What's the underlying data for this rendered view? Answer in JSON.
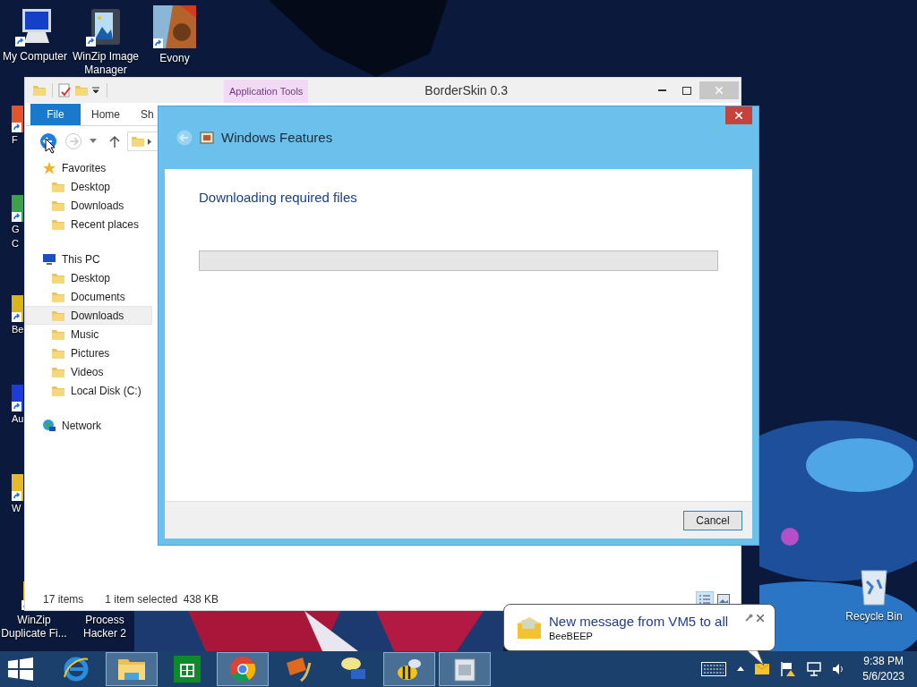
{
  "desktop": {
    "top_icons": [
      {
        "lines": [
          "My Computer"
        ]
      },
      {
        "lines": [
          "WinZip Image",
          "Manager"
        ]
      },
      {
        "lines": [
          "Evony"
        ]
      }
    ],
    "left_icons": [
      {
        "lines": [
          "F"
        ]
      },
      {
        "lines": [
          "G",
          "C"
        ]
      },
      {
        "lines": [
          "Be"
        ]
      },
      {
        "lines": [
          "Au"
        ]
      },
      {
        "lines": [
          "W"
        ]
      }
    ],
    "bottom_icons": [
      {
        "lines": [
          "WinZip",
          "Duplicate Fi..."
        ]
      },
      {
        "lines": [
          "Process",
          "Hacker 2"
        ]
      }
    ],
    "recycle_bin": {
      "lines": [
        "Recycle Bin"
      ]
    }
  },
  "explorer": {
    "title": "BorderSkin 0.3",
    "contextual_tab": "Application Tools",
    "ribbon_tabs": [
      {
        "label": "File",
        "selected": true
      },
      {
        "label": "Home",
        "selected": false
      },
      {
        "label": "Sh",
        "selected": false
      }
    ],
    "nav_pane": [
      {
        "label": "Favorites",
        "selected": false,
        "children": [
          {
            "label": "Desktop",
            "selected": false
          },
          {
            "label": "Downloads",
            "selected": false
          },
          {
            "label": "Recent places",
            "selected": false
          }
        ]
      },
      {
        "label": "This PC",
        "selected": false,
        "children": [
          {
            "label": "Desktop",
            "selected": false
          },
          {
            "label": "Documents",
            "selected": false
          },
          {
            "label": "Downloads",
            "selected": true
          },
          {
            "label": "Music",
            "selected": false
          },
          {
            "label": "Pictures",
            "selected": false
          },
          {
            "label": "Videos",
            "selected": false
          },
          {
            "label": "Local Disk (C:)",
            "selected": false
          }
        ]
      },
      {
        "label": "Network",
        "selected": false
      }
    ],
    "status_bar": {
      "items": "17 items",
      "selection": "1 item selected  438 KB"
    }
  },
  "dialog": {
    "title": "Windows Features",
    "heading": "Downloading required files",
    "progress": {
      "level": 0
    },
    "buttons": [
      "Cancel"
    ]
  },
  "notification": {
    "title": "New message from VM5 to all",
    "app": "BeeBEEP"
  },
  "taskbar": {
    "items": [
      {
        "kind": "start",
        "selected": false
      },
      {
        "kind": "browser",
        "selected": false
      },
      {
        "kind": "files",
        "selected": true
      },
      {
        "kind": "store",
        "selected": false
      },
      {
        "kind": "chrome",
        "selected": true
      },
      {
        "kind": "video",
        "selected": false
      },
      {
        "kind": "chat",
        "selected": false
      },
      {
        "kind": "bee",
        "selected": true
      },
      {
        "kind": "app",
        "selected": true
      }
    ],
    "clock": {
      "time": "9:38 PM",
      "date": "5/6/2023"
    }
  }
}
